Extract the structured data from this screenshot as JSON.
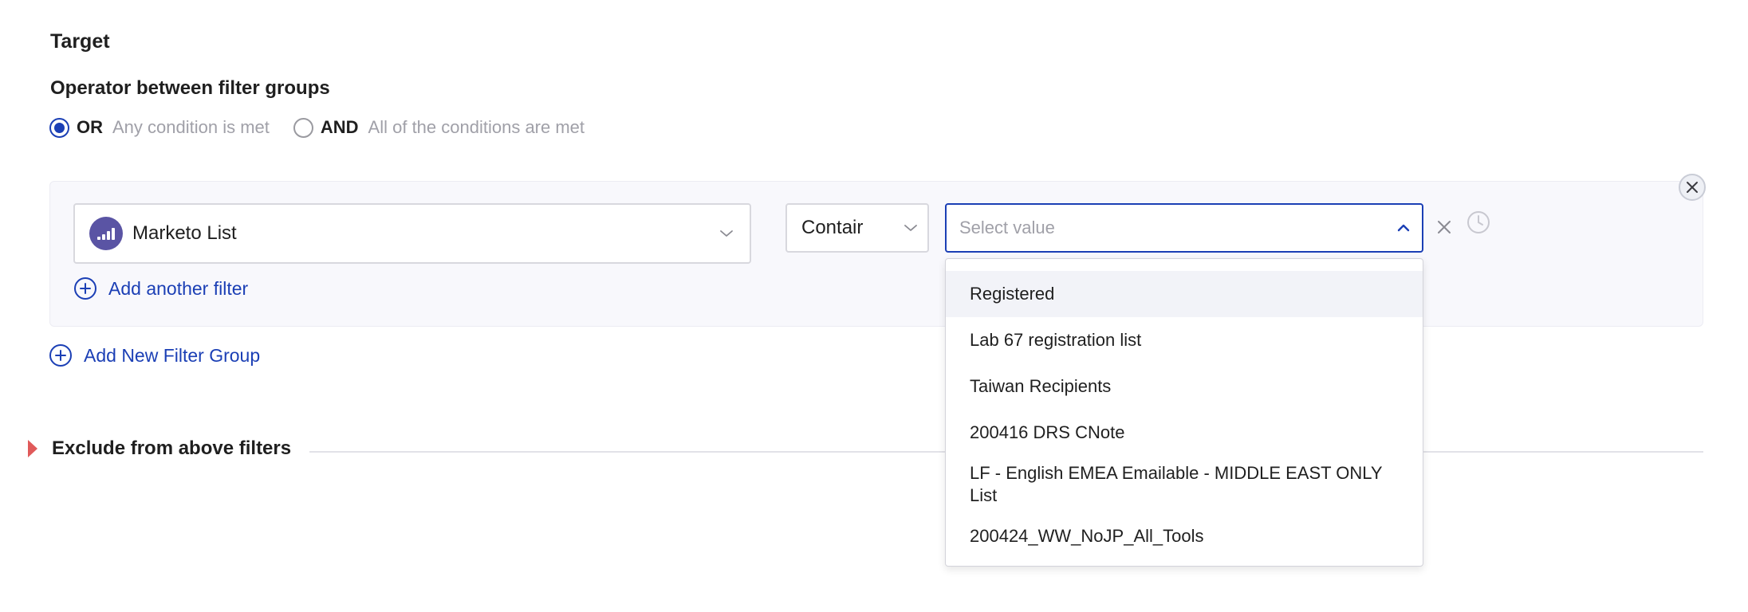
{
  "target": {
    "title": "Target"
  },
  "operator": {
    "heading": "Operator between filter groups",
    "options": [
      {
        "label": "OR",
        "description": "Any condition is met",
        "selected": true
      },
      {
        "label": "AND",
        "description": "All of the conditions are met",
        "selected": false
      }
    ]
  },
  "filter_group": {
    "field": {
      "label": "Marketo List",
      "icon": "marketo-logo-icon"
    },
    "operator_select": {
      "label": "Contair"
    },
    "value_select": {
      "value": "",
      "placeholder": "Select value",
      "open": true
    },
    "add_filter_label": "Add another filter",
    "dropdown_options": [
      "Registered",
      "Lab 67 registration list",
      "Taiwan Recipients",
      "200416 DRS CNote",
      "LF - English EMEA Emailable - MIDDLE EAST ONLY List",
      "200424_WW_NoJP_All_Tools"
    ]
  },
  "add_group_label": "Add New Filter Group",
  "exclude": {
    "label": "Exclude from above filters"
  },
  "colors": {
    "accent": "#1b3fb5",
    "caret": "#e05a5a",
    "group_bg": "#f8f8fc",
    "muted_text": "#a0a0a8",
    "marketo_purple": "#5a54a4"
  }
}
